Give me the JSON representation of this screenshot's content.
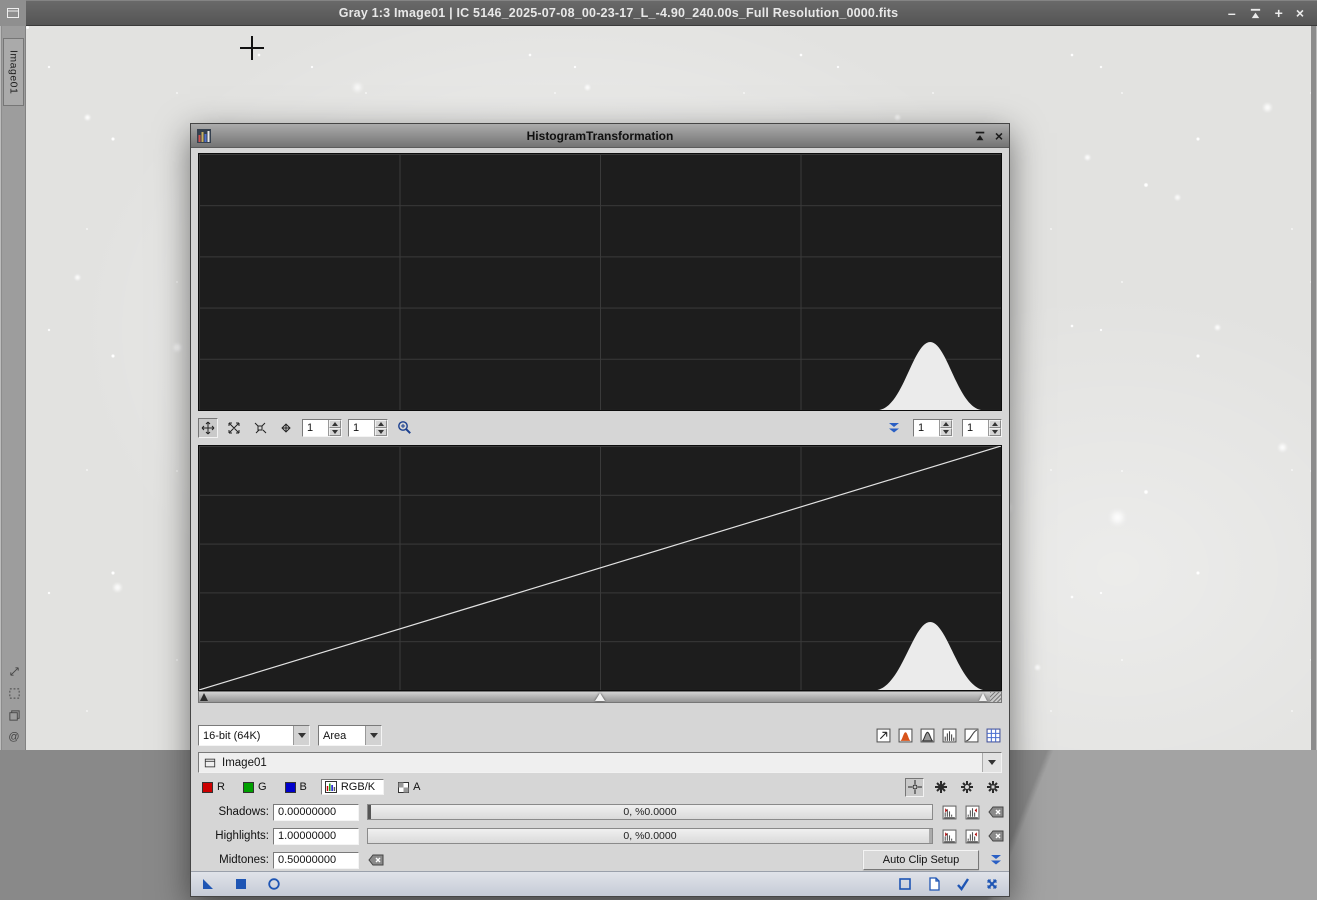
{
  "image_window": {
    "title": "Gray 1:3 Image01 | IC 5146_2025-07-08_00-23-17_L_-4.90_240.00s_Full Resolution_0000.fits",
    "tab_label": "Image01",
    "controls": {
      "minimize": "–",
      "pin": "+",
      "close": "×"
    }
  },
  "dialog": {
    "title": "HistogramTransformation",
    "close": "×",
    "zoom_toolbar": {
      "h_zoom": "1",
      "h_scroll": "1",
      "v_zoom": "1",
      "v_scroll": "1"
    },
    "display": {
      "resolution": "16-bit (64K)",
      "plot_style": "Area"
    },
    "view_selector": {
      "label": "Image01"
    },
    "channels": {
      "r": "R",
      "g": "G",
      "b": "B",
      "rgbk": "RGB/K",
      "a": "A"
    },
    "parameters": {
      "shadows": {
        "label": "Shadows:",
        "value": "0.00000000",
        "readout": "0, %0.0000"
      },
      "highlights": {
        "label": "Highlights:",
        "value": "1.00000000",
        "readout": "0, %0.0000"
      },
      "midtones": {
        "label": "Midtones:",
        "value": "0.50000000"
      }
    },
    "buttons": {
      "auto_clip": "Auto Clip Setup"
    }
  },
  "sidebar": {
    "at_symbol": "@"
  },
  "colors": {
    "accent_blue": "#1e55b4",
    "histogram_bg": "#1d1d1d",
    "channel_red": "#cc0000",
    "channel_green": "#00a000",
    "channel_blue": "#0000cc"
  }
}
